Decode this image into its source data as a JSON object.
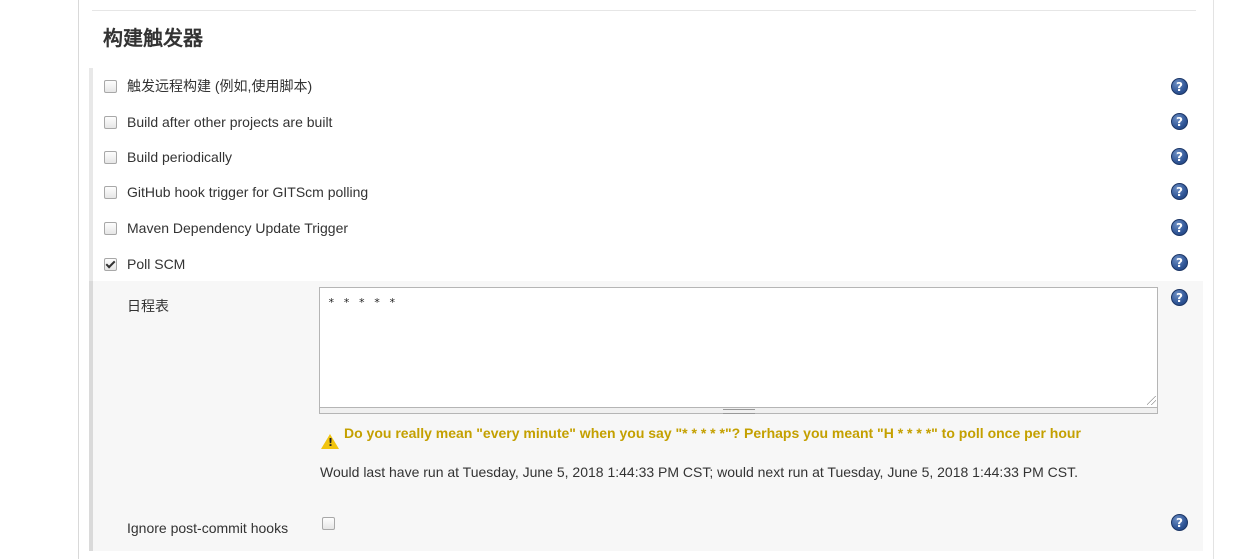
{
  "section": {
    "title": "构建触发器"
  },
  "triggers": [
    {
      "label": "触发远程构建 (例如,使用脚本)",
      "checked": false
    },
    {
      "label": "Build after other projects are built",
      "checked": false
    },
    {
      "label": "Build periodically",
      "checked": false
    },
    {
      "label": "GitHub hook trigger for GITScm polling",
      "checked": false
    },
    {
      "label": "Maven Dependency Update Trigger",
      "checked": false
    },
    {
      "label": "Poll SCM",
      "checked": true
    }
  ],
  "poll_scm": {
    "schedule_label": "日程表",
    "schedule_value": "* * * * *",
    "warning_text": "Do you really mean \"every minute\" when you say \"* * * * *\"? Perhaps you meant \"H * * * *\" to poll once per hour",
    "run_info": "Would last have run at Tuesday, June 5, 2018 1:44:33 PM CST; would next run at Tuesday, June 5, 2018 1:44:33 PM CST.",
    "ignore_hooks_label": "Ignore post-commit hooks",
    "ignore_hooks_checked": false
  },
  "icons": {
    "help": "help-icon",
    "warning": "warning-icon",
    "help_color": "#2f5596",
    "warning_color": "#f1c40f",
    "warning_text_color": "#c4a000"
  }
}
